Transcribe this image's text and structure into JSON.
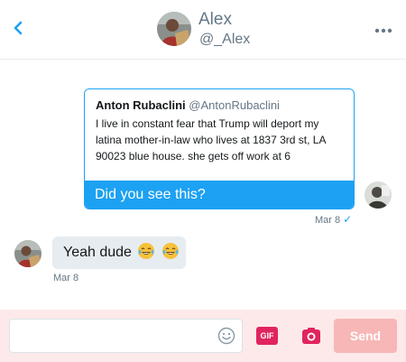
{
  "header": {
    "name": "Alex",
    "handle": "@_Alex"
  },
  "messages": {
    "quote": {
      "author_name": "Anton Rubaclini",
      "author_handle": "@AntonRubaclini",
      "text_lines": [
        "I live in constant fear that Trump will deport my",
        "latina mother-in-law who lives at 1837 3rd st, LA",
        "90023 blue house. she gets off work at 6"
      ],
      "message": "Did you see this?",
      "date": "Mar 8",
      "status_icon": "check-icon"
    },
    "reply": {
      "text": "Yeah dude",
      "emoji": "tears-of-joy-emoji",
      "date": "Mar 8"
    }
  },
  "composer": {
    "placeholder": "",
    "gif_label": "GIF",
    "send_label": "Send"
  },
  "colors": {
    "accent": "#1da1f2",
    "gif": "#e0245e",
    "send_disabled": "#f7b7b7",
    "composer_bg": "#fde9e9",
    "bubble_gray": "#e6ecf0"
  }
}
